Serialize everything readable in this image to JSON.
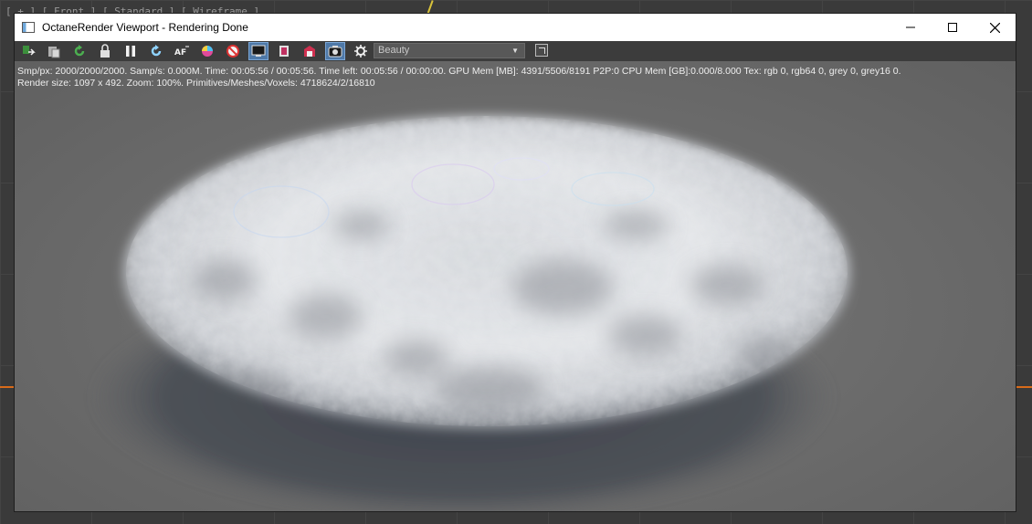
{
  "window": {
    "title": "OctaneRender Viewport - Rendering Done"
  },
  "background": {
    "viewport_label": "[ + ] [ Front ] [ Standard ] [ Wireframe ]"
  },
  "toolbar": {
    "buttons": [
      {
        "icon": "send-scene-icon"
      },
      {
        "icon": "copy-clipboard-icon"
      },
      {
        "icon": "reload-icon"
      },
      {
        "icon": "lock-icon"
      },
      {
        "icon": "pause-icon"
      },
      {
        "icon": "restart-icon"
      },
      {
        "icon": "af-focus-icon"
      },
      {
        "icon": "color-picker-icon"
      },
      {
        "icon": "material-picker-icon"
      },
      {
        "icon": "region-render-icon",
        "active": true
      },
      {
        "icon": "film-region-icon"
      },
      {
        "icon": "output-icon"
      },
      {
        "icon": "camera-icon",
        "active": true
      },
      {
        "icon": "settings-gear-icon"
      }
    ],
    "render_pass": "Beauty"
  },
  "stats": {
    "line1": "Smp/px: 2000/2000/2000.   Samp/s: 0.000M.   Time: 00:05:56 / 00:05:56.   Time left: 00:05:56 / 00:00:00.   GPU Mem [MB]: 4391/5506/8191 P2P:0    CPU Mem [GB]:0.000/8.000    Tex: rgb 0, rgb64 0, grey 0, grey16 0.",
    "line2": "Render size: 1097 x 492.   Zoom: 100%.   Primitives/Meshes/Voxels: 4718624/2/16810"
  },
  "colors": {
    "titlebar": "#ffffff",
    "toolbar": "#3c3c3c",
    "render_bg": "#6c6c6c",
    "active_button": "#4f79a8"
  }
}
